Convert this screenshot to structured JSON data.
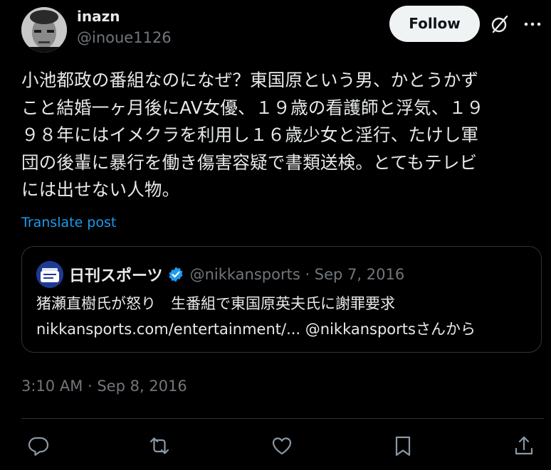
{
  "author": {
    "display_name": "inazn",
    "handle": "@inoue1126"
  },
  "header": {
    "follow_label": "Follow"
  },
  "post": {
    "text": "小池都政の番組なのになぜ？東国原という男、かとうかず\nこと結婚一ヶ月後にAV女優、１９歳の看護師と浮気、１９\n９８年にはイメクラを利用し１６歳少女と淫行、たけし軍\n団の後輩に暴行を働き傷害容疑で書類送検。とてもテレビ\nには出せない人物。",
    "translate_label": "Translate post",
    "timestamp": "3:10 AM · Sep 8, 2016"
  },
  "quote": {
    "name": "日刊スポーツ",
    "meta": "@nikkansports · Sep 7, 2016",
    "line1": "猪瀬直樹氏が怒り　生番組で東国原英夫氏に謝罪要求",
    "line2": "nikkansports.com/entertainment/... @nikkansportsさんから"
  },
  "actions": {
    "icons": [
      "reply-icon",
      "repost-icon",
      "like-icon",
      "bookmark-icon",
      "share-icon"
    ]
  },
  "colors": {
    "background": "#000000",
    "text": "#e7e9ea",
    "muted": "#71767b",
    "link": "#1d9bf0",
    "border": "#2f3336"
  }
}
